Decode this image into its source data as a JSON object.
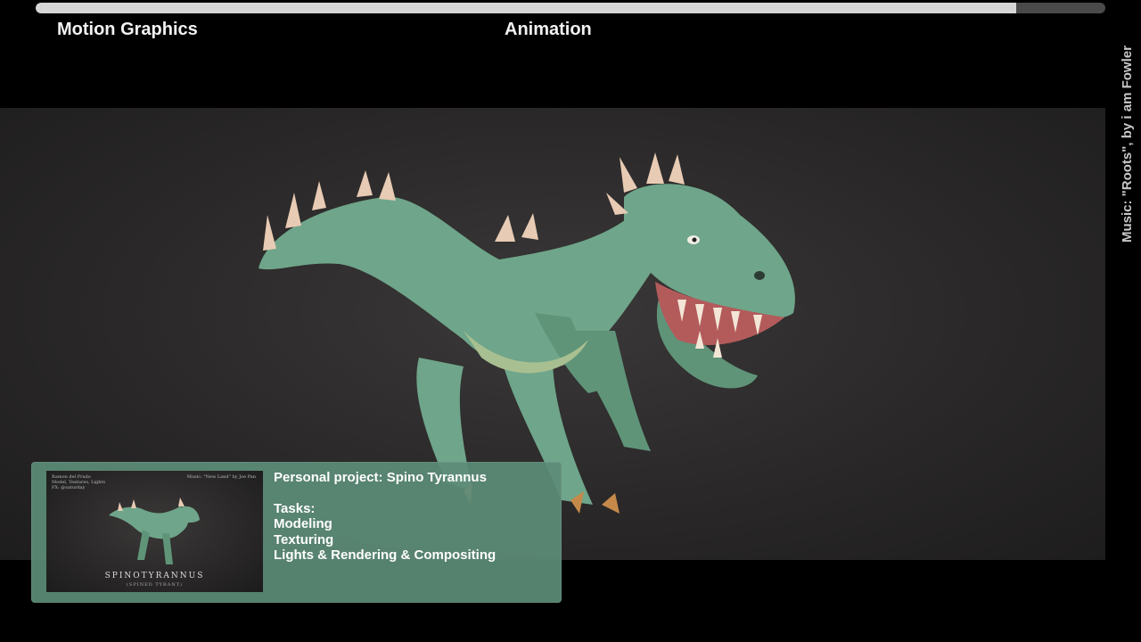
{
  "video": {
    "progress": 0.917,
    "labels": {
      "left": "Motion Graphics",
      "mid": "Animation"
    },
    "credit": "Music: \"Roots\", by i am Fowler"
  },
  "info_card": {
    "title": "Personal project: Spino Tyrannus",
    "tasks_heading": "Tasks:",
    "tasks": [
      "Modeling",
      "Texturing",
      "Lights & Rendering & Compositing"
    ],
    "thumbnail": {
      "author": "Ramon del Prado",
      "line2": "Model, Textures, Lights",
      "line3": "FX: @saturday",
      "music": "Music: \"New Land\" by Joe Pan",
      "title": "SPINOTYRANNUS",
      "subtitle": "(SPINED TYRANT)"
    }
  },
  "colors": {
    "skin": "#6fa58a",
    "skin_dark": "#4c7d66",
    "spikes": "#e8cbb4",
    "card": "#5c8c78"
  }
}
